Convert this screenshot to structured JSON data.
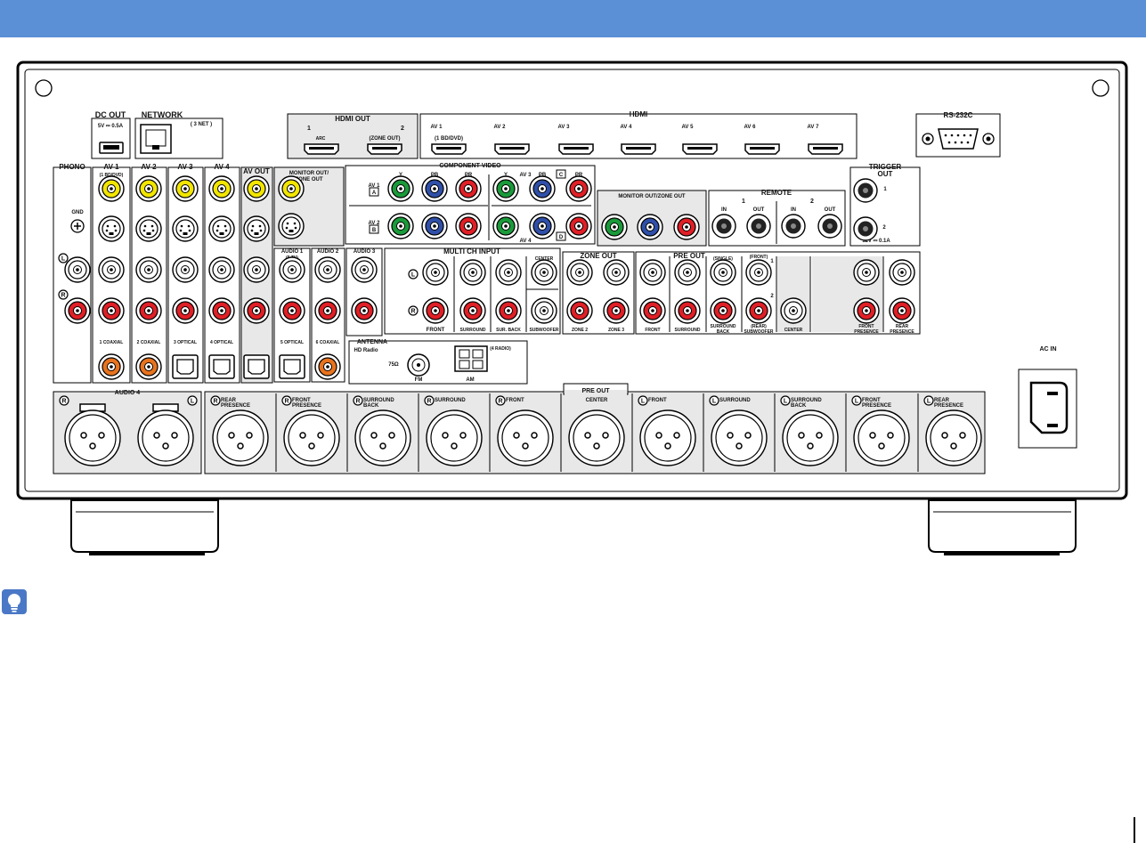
{
  "colors": {
    "banner": "#5b8fd6",
    "panel_fill": "#ffffff",
    "section_gray": "#e8e8e8",
    "jack_red": "#e01f26",
    "jack_yellow": "#f2e600",
    "jack_green": "#1a9a3a",
    "jack_blue": "#2f4fa8",
    "jack_orange": "#e8731e",
    "jack_white": "#ffffff"
  },
  "labels": {
    "dc_out": "DC OUT",
    "dc_out_rating": "5V ⎓ 0.5A",
    "network": "NETWORK",
    "network_sub": "( 3 NET )",
    "hdmi_out": "HDMI OUT",
    "hdmi_out_1": "1",
    "hdmi_out_2": "2",
    "hdmi_out_arc": "ARC",
    "hdmi_out_zone": "(ZONE OUT)",
    "hdmi": "HDMI",
    "hdmi_av1_sub": "(1 BD/DVD)",
    "hdmi_inputs": [
      "AV 1",
      "AV 2",
      "AV 3",
      "AV 4",
      "AV 5",
      "AV 6",
      "AV 7"
    ],
    "rs232c": "RS-232C",
    "phono": "PHONO",
    "gnd": "GND",
    "av1": "AV 1",
    "av1_sub": "(1 BD/DVD)",
    "av2": "AV 2",
    "av3": "AV 3",
    "av4": "AV 4",
    "av_out": "AV OUT",
    "monitor_out_zone_out": "MONITOR OUT/ ZONE OUT",
    "component_video": "COMPONENT VIDEO",
    "cv_y": "Y",
    "cv_pb": "PB",
    "cv_pr": "PR",
    "cv_av1": "AV 1",
    "cv_av2": "AV 2",
    "cv_av3": "AV 3",
    "cv_av4": "AV 4",
    "cv_a": "A",
    "cv_b": "B",
    "cv_c": "C",
    "cv_d": "D",
    "monitor_zone_out": "MONITOR OUT/ZONE OUT",
    "remote": "REMOTE",
    "remote_1": "1",
    "remote_2": "2",
    "in": "IN",
    "out": "OUT",
    "trigger_out": "TRIGGER OUT",
    "trigger_1": "1",
    "trigger_2": "2",
    "trigger_rating": "12V ⎓ 0.1A",
    "audio1": "AUDIO 1",
    "audio1_sub": "(5 TV)",
    "audio2": "AUDIO 2",
    "audio3": "AUDIO 3",
    "multi_ch_input": "MULTI CH INPUT",
    "mc_center": "CENTER",
    "mc_front": "FRONT",
    "mc_surround": "SURROUND",
    "mc_sur_back": "SUR. BACK",
    "mc_subwoofer": "SUBWOOFER",
    "zone_out": "ZONE OUT",
    "zone2": "ZONE 2",
    "zone3": "ZONE 3",
    "pre_out": "PRE OUT",
    "po_single": "(SINGLE)",
    "po_front_top": "(FRONT)",
    "po_1": "1",
    "po_2": "2",
    "po_front": "FRONT",
    "po_surround": "SURROUND",
    "po_surround_back": "SURROUND BACK",
    "po_rear_sub": "(REAR) SUBWOOFER",
    "po_center": "CENTER",
    "po_front_presence": "FRONT PRESENCE",
    "po_rear_presence": "REAR PRESENCE",
    "digital_labels": [
      "1 COAXIAL",
      "2 COAXIAL",
      "3 OPTICAL",
      "4 OPTICAL",
      "5 OPTICAL",
      "6 COAXIAL"
    ],
    "antenna": "ANTENNA",
    "hd_radio": "HD Radio",
    "ohm75": "75Ω",
    "fm": "FM",
    "am": "AM",
    "radio4": "(4 RADIO)",
    "audio4": "AUDIO 4",
    "xlr_pre_out": "PRE OUT",
    "xlr_labels": [
      "REAR PRESENCE",
      "FRONT PRESENCE",
      "SURROUND BACK",
      "SURROUND",
      "FRONT",
      "CENTER",
      "FRONT",
      "SURROUND",
      "SURROUND BACK",
      "FRONT PRESENCE",
      "REAR PRESENCE"
    ],
    "lr_l": "L",
    "lr_r": "R",
    "ac_in": "AC IN"
  }
}
